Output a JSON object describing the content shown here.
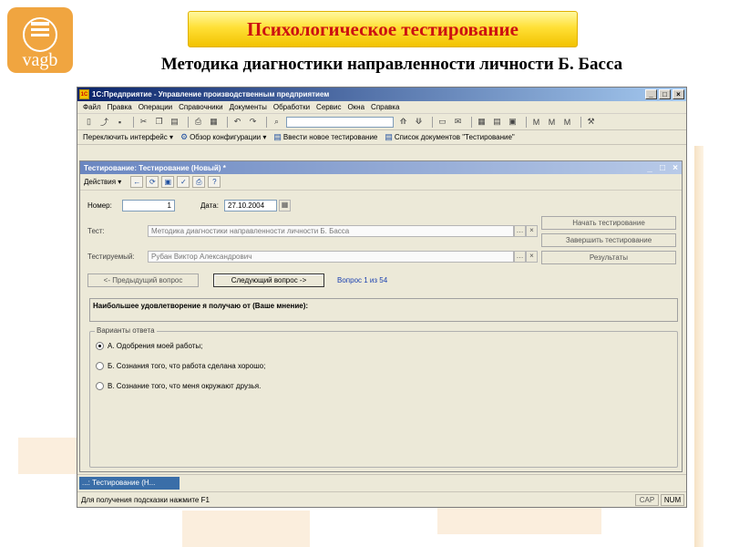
{
  "slide": {
    "logo_text": "vagb",
    "title": "Психологическое тестирование",
    "subtitle": "Методика диагностики направленности личности Б. Басса"
  },
  "window": {
    "app_icon": "1С",
    "title": "1С:Предприятие - Управление производственным предприятием"
  },
  "menu": [
    "Файл",
    "Правка",
    "Операции",
    "Справочники",
    "Документы",
    "Обработки",
    "Сервис",
    "Окна",
    "Справка"
  ],
  "toolbar2": {
    "switch_interface": "Переключить интерфейс",
    "config_overview": "Обзор конфигурации",
    "new_test": "Ввести новое тестирование",
    "doc_list": "Список документов \"Тестирование\""
  },
  "form": {
    "title": "Тестирование: Тестирование (Новый) *",
    "actions_label": "Действия",
    "number_label": "Номер:",
    "number_value": "1",
    "date_label": "Дата:",
    "date_value": "27.10.2004",
    "test_label": "Тест:",
    "test_value": "Методика диагностики направленности личности Б. Басса",
    "subject_label": "Тестируемый:",
    "subject_value": "Рубан Виктор Александрович",
    "start_button": "Начать тестирование",
    "finish_button": "Завершить тестирование",
    "results_button": "Результаты",
    "prev_button": "<- Предыдущий вопрос",
    "next_button": "Следующий вопрос ->",
    "counter": "Вопрос 1 из 54",
    "question": "Наибольшее удовлетворение я получаю от (Ваше мнение):",
    "answers_legend": "Варианты ответа",
    "answers": [
      "А. Одобрения моей работы;",
      "Б. Сознания того, что работа сделана хорошо;",
      "В. Сознание того, что меня окружают друзья."
    ],
    "selected_answer": 0
  },
  "taskbar": {
    "task_label": "...: Тестирование (Н..."
  },
  "status": {
    "hint": "Для получения подсказки нажмите F1",
    "cap": "CAP",
    "num": "NUM"
  }
}
